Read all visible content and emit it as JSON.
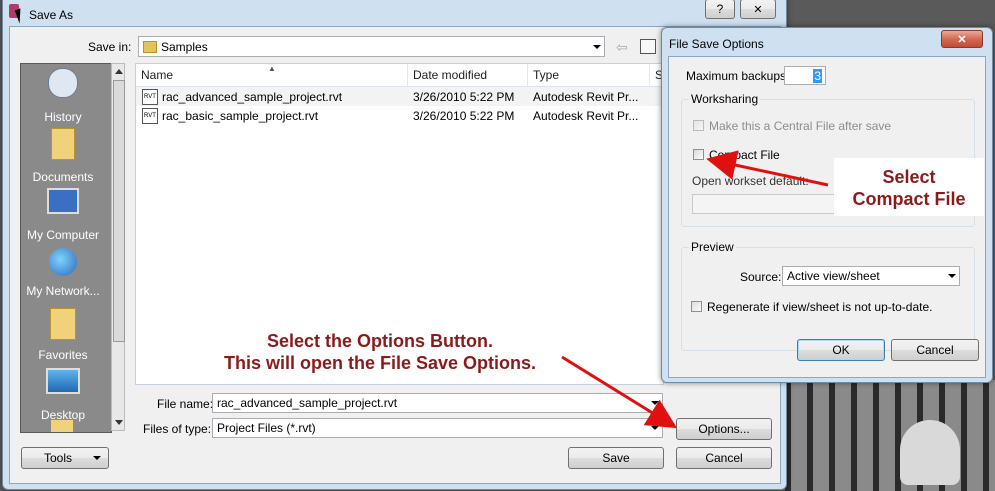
{
  "save_as": {
    "title": "Save As",
    "help_label": "?",
    "close_label": "✕",
    "save_in_label": "Save in:",
    "save_in_value": "Samples",
    "places": [
      {
        "label": "History",
        "icon": "history-icon"
      },
      {
        "label": "Documents",
        "icon": "documents-folder-icon"
      },
      {
        "label": "My Computer",
        "icon": "computer-icon"
      },
      {
        "label": "My Network...",
        "icon": "network-globe-icon"
      },
      {
        "label": "Favorites",
        "icon": "favorites-folder-icon"
      },
      {
        "label": "Desktop",
        "icon": "desktop-icon"
      }
    ],
    "columns": {
      "name": "Name",
      "date": "Date modified",
      "type": "Type",
      "size": "Si"
    },
    "files": [
      {
        "name": "rac_advanced_sample_project.rvt",
        "date": "3/26/2010 5:22 PM",
        "type": "Autodesk Revit Pr...",
        "icon_text": "RVT"
      },
      {
        "name": "rac_basic_sample_project.rvt",
        "date": "3/26/2010 5:22 PM",
        "type": "Autodesk Revit Pr...",
        "icon_text": "RVT"
      }
    ],
    "file_name_label": "File name:",
    "file_name_value": "rac_advanced_sample_project.rvt",
    "file_type_label": "Files of type:",
    "file_type_value": "Project Files  (*.rvt)",
    "options_button": "Options...",
    "tools_button": "Tools",
    "save_button": "Save",
    "cancel_button": "Cancel"
  },
  "file_save_options": {
    "title": "File Save Options",
    "close_label": "✕",
    "max_backups_label": "Maximum backups:",
    "max_backups_value": "3",
    "worksharing_label": "Worksharing",
    "central_file_label": "Make this a Central File after save",
    "compact_file_label": "Compact File",
    "open_workset_label": "Open workset default:",
    "preview_label": "Preview",
    "source_label": "Source:",
    "source_value": "Active view/sheet",
    "regenerate_label": "Regenerate if view/sheet is not up-to-date.",
    "ok_button": "OK",
    "cancel_button": "Cancel"
  },
  "annotations": {
    "options_line1": "Select the Options Button.",
    "options_line2": "This will open the File Save Options.",
    "compact_line1": "Select",
    "compact_line2": "Compact File"
  },
  "colors": {
    "annotation_text": "#8b1a1a",
    "arrow": "#e01010",
    "places_bg": "#8a8a8a"
  }
}
